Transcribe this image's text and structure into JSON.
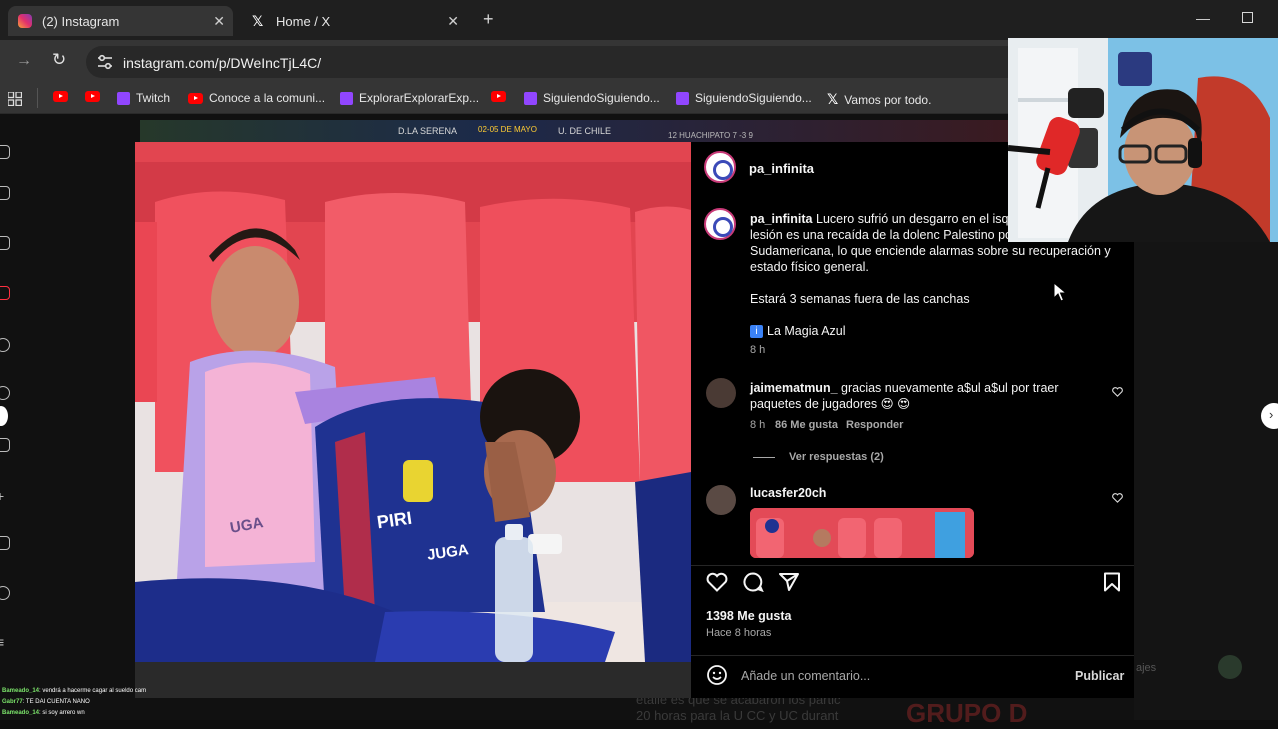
{
  "tabs": [
    {
      "title": "(2) Instagram",
      "active": true
    },
    {
      "title": "Home / X",
      "active": false
    }
  ],
  "omnibox": {
    "url": "instagram.com/p/DWeIncTjL4C/"
  },
  "bookmarks": [
    {
      "icon": "youtube-icon",
      "label": ""
    },
    {
      "icon": "youtube-icon",
      "label": ""
    },
    {
      "icon": "twitch-icon",
      "label": "Twitch"
    },
    {
      "icon": "youtube-icon",
      "label": "Conoce a la comuni..."
    },
    {
      "icon": "twitch-icon",
      "label": "ExplorarExplorarExp..."
    },
    {
      "icon": "youtube-icon",
      "label": ""
    },
    {
      "icon": "twitch-icon",
      "label": "SiguiendoSiguiendo..."
    },
    {
      "icon": "twitch-icon",
      "label": "SiguiendoSiguiendo..."
    },
    {
      "icon": "x-icon",
      "label": "Vamos por todo."
    }
  ],
  "background": {
    "team_left": "D.LA SERENA",
    "match_date": "02-05 DE MAYO",
    "team_right": "U. DE CHILE",
    "table_row": "12  HUACHIPATO   7  -3  9",
    "right_text": "ajes",
    "bottom_text": "etalle es que se acabaron los partic",
    "bottom_text2": "20 horas para la U  CC y UC durant",
    "bottom_banner": "GRUPO D"
  },
  "post": {
    "author": "pa_infinita",
    "caption_author": "pa_infinita",
    "caption_text": "Lucero sufrió un desgarro en el isqu izquierda. La lesión es una recaída de la dolenc Palestino por Copa Sudamericana, lo que enciende alarmas sobre su recuperación y estado físico general.",
    "caption_line2": "Estará 3 semanas fuera de las canchas",
    "caption_line3": "La Magia Azul",
    "caption_time": "8 h",
    "photo_text_1": "PIRI",
    "photo_text_2": "JUGA",
    "photo_text_3": "UGA",
    "likes": "1398 Me gusta",
    "posted": "Hace 8 horas",
    "comment_placeholder": "Añade un comentario...",
    "publish_label": "Publicar"
  },
  "comments": [
    {
      "user": "jaimematmun_",
      "text": "gracias nuevamente a$ul a$ul por traer paquetes de jugadores 😍 😍",
      "time": "8 h",
      "likes": "86 Me gusta",
      "reply": "Responder",
      "view_replies": "Ver respuestas (2)"
    },
    {
      "user": "lucasfer20ch",
      "text": ""
    }
  ],
  "chat": [
    {
      "user": "Bameado_14",
      "msg": ": vendrá a hacerme cagar al sueldo cam"
    },
    {
      "user": "Gabr77",
      "msg": ": TE DAI CUENTA NANO"
    },
    {
      "user": "Bameado_14",
      "msg": ": si soy arrero wn"
    }
  ],
  "colors": {
    "instagram_bg": "#000000",
    "browser_chrome": "#353535",
    "uchile_blue": "#1a2f8a",
    "bench_red": "#e23040"
  }
}
